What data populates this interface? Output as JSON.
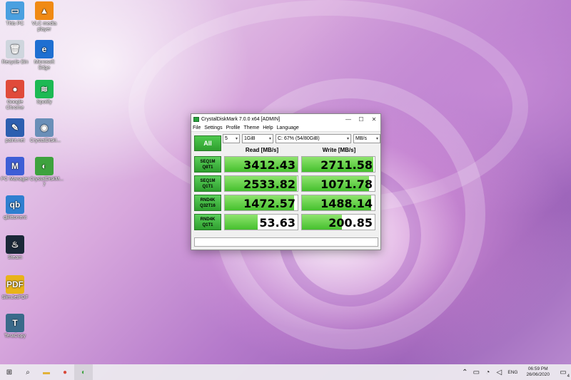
{
  "desktop": {
    "icons": [
      {
        "label": "This PC",
        "icon": "this-pc-icon",
        "color": "#4aa0e0",
        "glyph": "▭"
      },
      {
        "label": "VLC media player",
        "icon": "vlc-icon",
        "color": "#f08a14",
        "glyph": "▲"
      },
      {
        "label": "Recycle Bin",
        "icon": "recycle-bin-icon",
        "color": "#cfd6de",
        "glyph": "🗑"
      },
      {
        "label": "Microsoft Edge",
        "icon": "edge-icon",
        "color": "#1f6fd1",
        "glyph": "e"
      },
      {
        "label": "Google Chrome",
        "icon": "chrome-icon",
        "color": "#e04a3a",
        "glyph": "●"
      },
      {
        "label": "Spotify",
        "icon": "spotify-icon",
        "color": "#1db954",
        "glyph": "≋"
      },
      {
        "label": "paint.net",
        "icon": "paintnet-icon",
        "color": "#2d5fb0",
        "glyph": "✎"
      },
      {
        "label": "CrystalDiskI...",
        "icon": "crystaldiskinfo-icon",
        "color": "#6a8fb8",
        "glyph": "◉"
      },
      {
        "label": "PC Manager",
        "icon": "pc-manager-icon",
        "color": "#3e5ed6",
        "glyph": "M"
      },
      {
        "label": "CrystalDiskM... 7",
        "icon": "crystaldiskmark-icon",
        "color": "#3ea23e",
        "glyph": "◐"
      },
      {
        "label": "qBittorrent",
        "icon": "qbittorrent-icon",
        "color": "#2f7fd0",
        "glyph": "qb"
      },
      {
        "label": "Steam",
        "icon": "steam-icon",
        "color": "#1b2838",
        "glyph": "♨"
      },
      {
        "label": "SlimJetPDF",
        "icon": "pdf-icon",
        "color": "#e8b319",
        "glyph": "PDF"
      },
      {
        "label": "TeraCopy",
        "icon": "teracopy-icon",
        "color": "#3a6a8a",
        "glyph": "T"
      }
    ]
  },
  "window": {
    "title": "CrystalDiskMark 7.0.0 x64 [ADMIN]",
    "controls": {
      "minimize": "—",
      "maximize": "☐",
      "close": "✕"
    },
    "menu": [
      "File",
      "Settings",
      "Profile",
      "Theme",
      "Help",
      "Language"
    ],
    "toolbar": {
      "count": "5",
      "size": "1GiB",
      "drive": "C: 67% (54/80GiB)",
      "unit": "MB/s"
    },
    "all_label": "All",
    "headers": {
      "read": "Read [MB/s]",
      "write": "Write [MB/s]"
    },
    "rows": [
      {
        "line1": "SEQ1M",
        "line2": "Q8T1",
        "read": "3412.43",
        "write": "2711.58",
        "read_frac": 1.0,
        "write_frac": 0.98
      },
      {
        "line1": "SEQ1M",
        "line2": "Q1T1",
        "read": "2533.82",
        "write": "1071.78",
        "read_frac": 0.99,
        "write_frac": 0.92
      },
      {
        "line1": "RND4K",
        "line2": "Q32T16",
        "read": "1472.57",
        "write": "1488.14",
        "read_frac": 0.95,
        "write_frac": 0.95
      },
      {
        "line1": "RND4K",
        "line2": "Q1T1",
        "read": "53.63",
        "write": "200.85",
        "read_frac": 0.45,
        "write_frac": 0.55
      }
    ]
  },
  "taskbar": {
    "apps": [
      {
        "icon": "start-icon",
        "glyph": "⊞"
      },
      {
        "icon": "search-icon",
        "glyph": "⌕"
      },
      {
        "icon": "file-explorer-icon",
        "glyph": "▬"
      },
      {
        "icon": "chrome-icon",
        "glyph": "●"
      },
      {
        "icon": "crystaldiskmark-icon",
        "glyph": "◐"
      }
    ],
    "tray": {
      "language": "ENG",
      "time": "06:59 PM",
      "date": "26/06/2020",
      "notification_count": "4"
    }
  },
  "colors": {
    "accent_green": "#45c02d",
    "window_bg": "#f0f0f0"
  }
}
